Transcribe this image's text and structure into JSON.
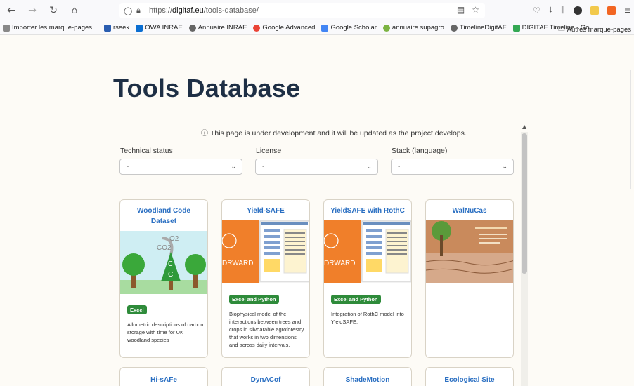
{
  "browser": {
    "url_prefix": "https://",
    "url_host": "digitaf.eu",
    "url_path": "/tools-database/",
    "bookmarks": [
      {
        "label": "Importer les marque-pages...",
        "color": "#888"
      },
      {
        "label": "rseek",
        "color": "#2a5db0"
      },
      {
        "label": "OWA INRAE",
        "color": "#0a6ed1"
      },
      {
        "label": "Annuaire INRAE",
        "color": "#666"
      },
      {
        "label": "Google Advanced",
        "color": "#ea4335"
      },
      {
        "label": "Google Scholar",
        "color": "#4285f4"
      },
      {
        "label": "annuaire supagro",
        "color": "#7cb342"
      },
      {
        "label": "TimelineDigitAF",
        "color": "#666"
      },
      {
        "label": "DIGITAF Timeline - Go...",
        "color": "#34a853"
      }
    ],
    "other_bookmarks": "Autres marque-pages"
  },
  "page": {
    "title": "Tools Database",
    "notice": "This page is under development and it will be updated as the project develops."
  },
  "filters": [
    {
      "label": "Technical status",
      "value": "-"
    },
    {
      "label": "License",
      "value": "-"
    },
    {
      "label": "Stack (language)",
      "value": "-"
    }
  ],
  "cards": [
    {
      "title": "Woodland Code Dataset",
      "badge": "Excel",
      "description": "Allometric descriptions of carbon storage with time for UK woodland species",
      "img_texts": [
        "O2",
        "CO2",
        "C",
        "C"
      ]
    },
    {
      "title": "Yield-SAFE",
      "badge": "Excel and Python",
      "description": "Biophysical model of the interactions between trees and crops in silvoarable agroforestry that works in two dimensions and across daily intervals.",
      "img_texts": [
        "DRWARD"
      ]
    },
    {
      "title": "YieldSAFE with RothC",
      "badge": "Excel and Python",
      "description": "Integration of RothC model into YieldSAFE.",
      "img_texts": [
        "DRWARD"
      ]
    },
    {
      "title": "WalNuCas",
      "badge": "",
      "description": "",
      "img_texts": []
    }
  ],
  "next_cards": [
    {
      "title": "Hi-sAFe"
    },
    {
      "title": "DynACof"
    },
    {
      "title": "ShadeMotion"
    },
    {
      "title": "Ecological Site"
    }
  ]
}
